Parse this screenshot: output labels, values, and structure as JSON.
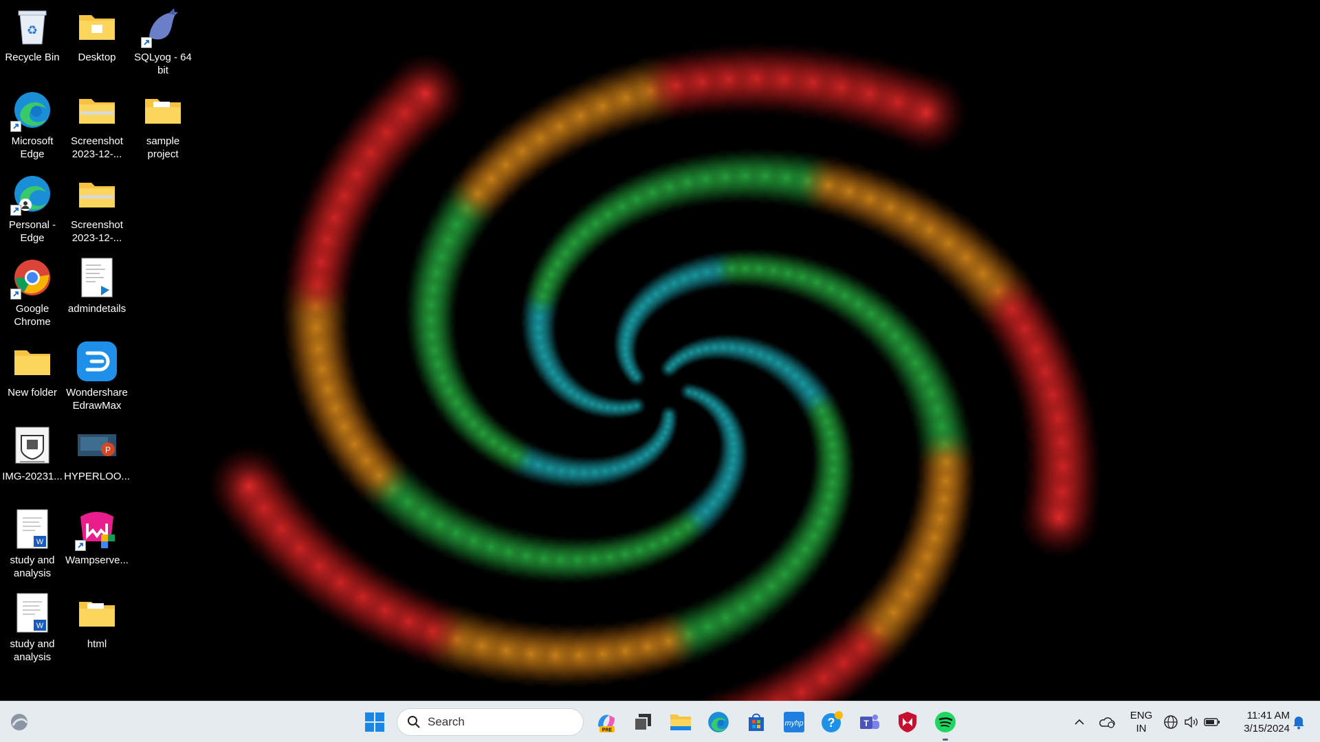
{
  "desktop": {
    "icons": [
      {
        "name": "Recycle Bin"
      },
      {
        "name": "Desktop"
      },
      {
        "name": "SQLyog - 64 bit"
      },
      {
        "name": "Microsoft Edge"
      },
      {
        "name": "Screenshot 2023-12-..."
      },
      {
        "name": "sample project"
      },
      {
        "name": "Personal - Edge"
      },
      {
        "name": "Screenshot 2023-12-..."
      },
      {
        "name": "Google Chrome"
      },
      {
        "name": "admindetails"
      },
      {
        "name": "New folder"
      },
      {
        "name": "Wondershare EdrawMax"
      },
      {
        "name": "IMG-20231..."
      },
      {
        "name": "HYPERLOO..."
      },
      {
        "name": "study and analysis"
      },
      {
        "name": "Wampserve..."
      },
      {
        "name": "study and analysis"
      },
      {
        "name": "html"
      }
    ]
  },
  "taskbar": {
    "search_placeholder": "Search",
    "apps": [
      "start",
      "copilot-pre",
      "task-view",
      "file-explorer",
      "edge",
      "microsoft-store",
      "myhp",
      "get-help",
      "teams",
      "mcafee",
      "spotify"
    ],
    "tray": {
      "lang_top": "ENG",
      "lang_bottom": "IN",
      "time": "11:41 AM",
      "date": "3/15/2024"
    }
  },
  "colors": {
    "taskbar_bg": "#e6ebf0",
    "folder": "#f6c342",
    "accent": "#0067c0"
  }
}
